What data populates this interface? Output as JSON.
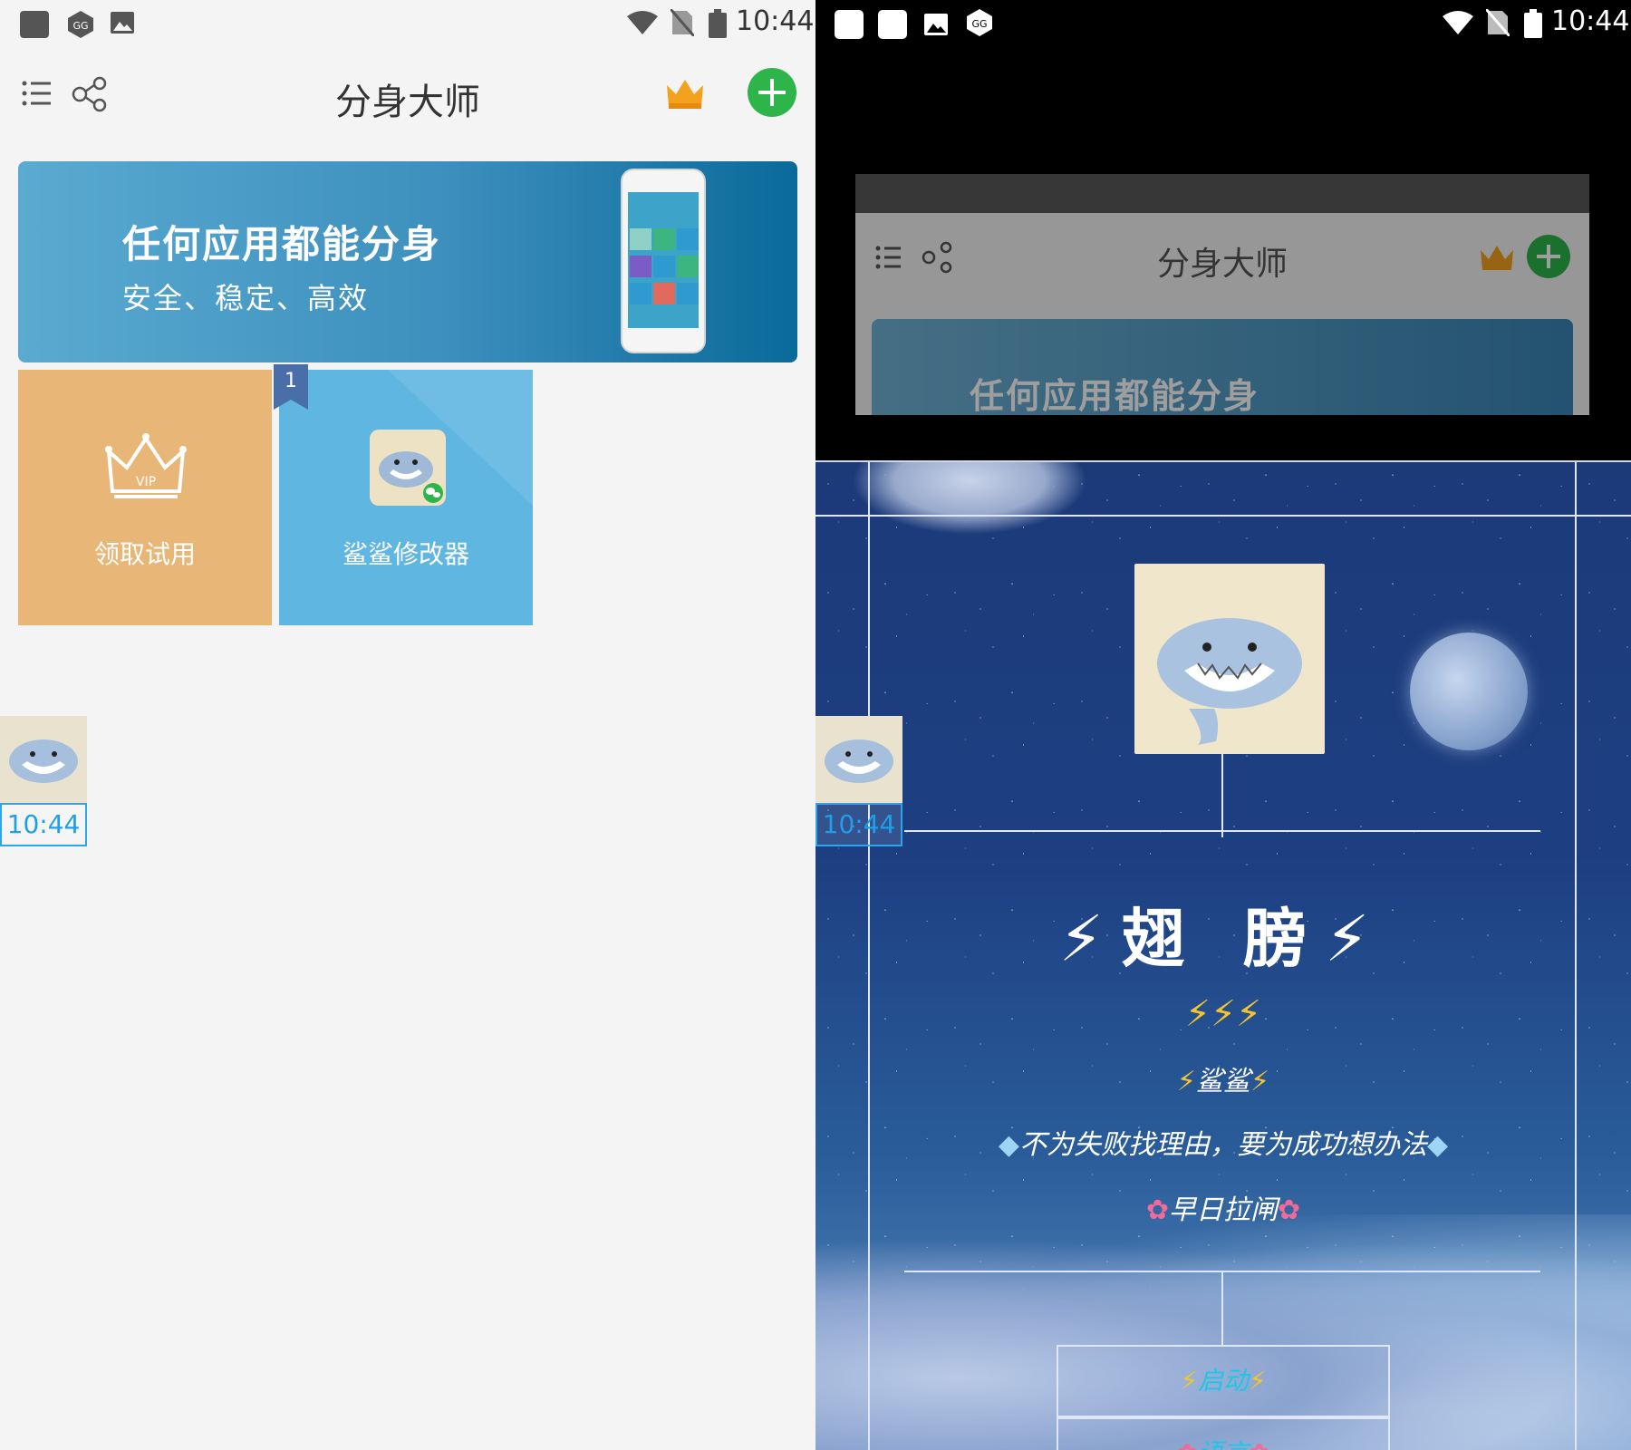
{
  "left_pane": {
    "status_bar": {
      "time": "10:44"
    },
    "toolbar": {
      "title": "分身大师"
    },
    "banner": {
      "title": "任何应用都能分身",
      "subtitle": "安全、稳定、高效"
    },
    "tiles": [
      {
        "label": "领取试用",
        "icon": "vip-crown-icon"
      },
      {
        "label": "鲨鲨修改器",
        "icon": "shark-app-icon",
        "badge": "1"
      }
    ],
    "floating_widget": {
      "time": "10:44"
    }
  },
  "right_pane": {
    "status_bar": {
      "time": "10:44"
    },
    "recents_card": {
      "title": "分身大师",
      "banner_title": "任何应用都能分身"
    },
    "floating_widget": {
      "time": "10:44"
    },
    "mod_menu": {
      "title": "⚡翅 膀⚡",
      "bolts": "⚡⚡⚡",
      "name_line": "鲨鲨",
      "motto": "不为失败找理由，要为成功想办法",
      "wish": "早日拉闸",
      "buttons": [
        {
          "label": "启动"
        },
        {
          "label": "语言"
        }
      ]
    }
  },
  "colors": {
    "accent_green": "#2db54a",
    "vip_tile": "#e8b777",
    "app_tile": "#5fb6e1",
    "badge": "#4a6fa8",
    "widget_blue": "#1e9fe8"
  }
}
